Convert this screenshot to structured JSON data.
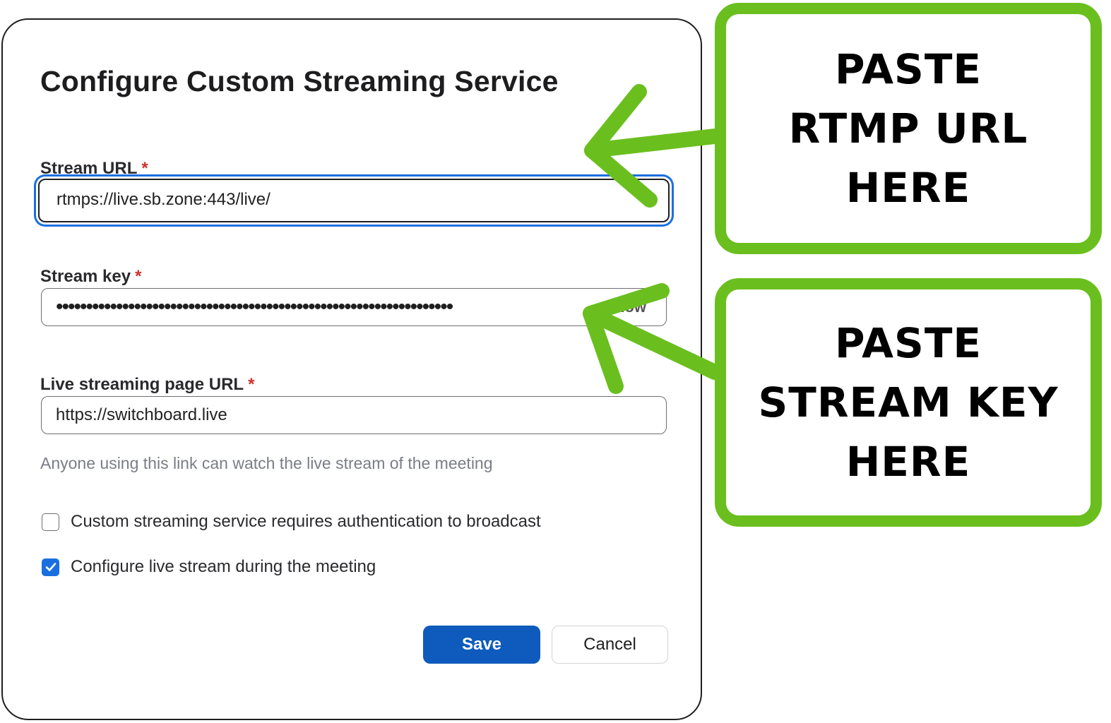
{
  "dialog": {
    "title": "Configure Custom Streaming Service",
    "stream_url": {
      "label": "Stream URL",
      "required": "*",
      "value": "rtmps://live.sb.zone:443/live/"
    },
    "stream_key": {
      "label": "Stream key",
      "required": "*",
      "value": "••••••••••••••••••••••••••••••••••••••••••••••••••••••••••••••••••",
      "show_label": "Show"
    },
    "live_page_url": {
      "label": "Live streaming page URL",
      "required": "*",
      "value": "https://switchboard.live"
    },
    "helper_text": "Anyone using this link can watch the live stream of the meeting",
    "checkbox_auth": {
      "label": "Custom streaming service requires authentication to broadcast",
      "checked": false
    },
    "checkbox_configure": {
      "label": "Configure live stream during the meeting",
      "checked": true
    },
    "save_label": "Save",
    "cancel_label": "Cancel"
  },
  "callouts": {
    "rtmp": {
      "line1": "PASTE",
      "line2": "RTMP URL",
      "line3": "HERE"
    },
    "key": {
      "line1": "PASTE",
      "line2": "STREAM KEY",
      "line3": "HERE"
    }
  },
  "colors": {
    "accent_green": "#6abf1e",
    "primary_blue": "#0e5bbd",
    "focus_blue": "#1a6fe0",
    "required_red": "#d0312d"
  },
  "icons": [
    "arrow-left-icon",
    "checkmark-icon"
  ]
}
